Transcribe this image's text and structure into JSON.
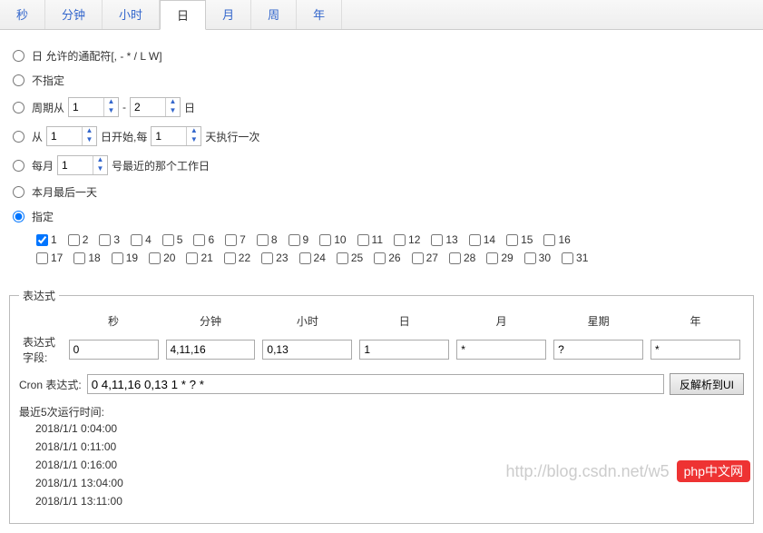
{
  "tabs": [
    "秒",
    "分钟",
    "小时",
    "日",
    "月",
    "周",
    "年"
  ],
  "activeTab": "日",
  "options": {
    "wildcard": "日 允许的通配符[, - * / L W]",
    "unspecified": "不指定",
    "periodFrom": "周期从",
    "periodFromVal": "1",
    "periodToVal": "2",
    "periodSuffix": "日",
    "from": "从",
    "fromVal": "1",
    "fromMid": "日开始,每",
    "fromIntervalVal": "1",
    "fromSuffix": "天执行一次",
    "monthly": "每月",
    "monthlyVal": "1",
    "monthlySuffix": "号最近的那个工作日",
    "lastDay": "本月最后一天",
    "specified": "指定"
  },
  "days": [
    "1",
    "2",
    "3",
    "4",
    "5",
    "6",
    "7",
    "8",
    "9",
    "10",
    "11",
    "12",
    "13",
    "14",
    "15",
    "16",
    "17",
    "18",
    "19",
    "20",
    "21",
    "22",
    "23",
    "24",
    "25",
    "26",
    "27",
    "28",
    "29",
    "30",
    "31"
  ],
  "checkedDays": [
    "1"
  ],
  "expr": {
    "fieldsetLabel": "表达式",
    "fieldsLabel": "表达式字段:",
    "headers": [
      "秒",
      "分钟",
      "小时",
      "日",
      "月",
      "星期",
      "年"
    ],
    "values": [
      "0",
      "4,11,16",
      "0,13",
      "1",
      "*",
      "?",
      "*"
    ],
    "cronLabel": "Cron 表达式:",
    "cronValue": "0 4,11,16 0,13 1 * ? *",
    "button": "反解析到UI"
  },
  "runs": {
    "label": "最近5次运行时间:",
    "items": [
      "2018/1/1 0:04:00",
      "2018/1/1 0:11:00",
      "2018/1/1 0:16:00",
      "2018/1/1 13:04:00",
      "2018/1/1 13:11:00"
    ]
  },
  "watermark": {
    "url": "http://blog.csdn.net/w5",
    "brand": "php中文网"
  }
}
